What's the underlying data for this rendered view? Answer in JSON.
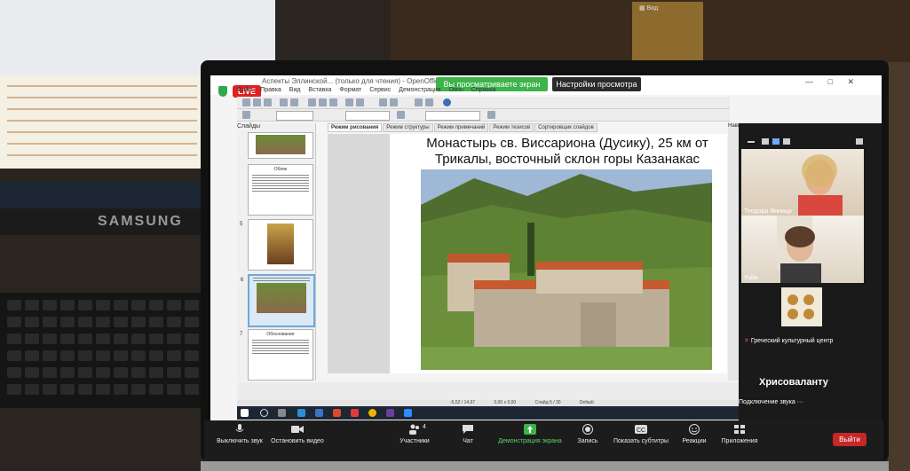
{
  "impress": {
    "window_title": "Аспекты Эллинской... (только для чтения) - OpenOffice Impress",
    "live_badge": "LIVE",
    "menu": [
      "Файл",
      "Правка",
      "Вид",
      "Вставка",
      "Формат",
      "Сервис",
      "Демонстрация",
      "Окно",
      "Справка"
    ],
    "view_tabs": [
      "Режим рисования",
      "Режим структуры",
      "Режим примечаний",
      "Режим тезисов",
      "Сортировщик слайдов"
    ],
    "slides_panel_title": "Слайды",
    "navigator_title": "Навигатор",
    "thumbnails": [
      {
        "num": "",
        "title": ""
      },
      {
        "num": "",
        "title": "Облик"
      },
      {
        "num": "5",
        "title": ""
      },
      {
        "num": "6",
        "title": ""
      },
      {
        "num": "7",
        "title": "Обоснование"
      }
    ],
    "slide_title_line1": "Монастырь св. Виссариона  (Дусику), 25 км от",
    "slide_title_line2": "Трикалы, восточный склон горы Казанакас",
    "status_coords": "-5,52 / 14,97",
    "status_size": "0,00 x 0,00",
    "status_slide": "Слайд 5 / 30",
    "status_layout": "Default"
  },
  "zoom": {
    "share_banner": "Вы просматриваете экран Yulia",
    "view_settings": "Настройки просмотра",
    "view_label": "Вид",
    "participants": [
      {
        "name": "Теодора Янници"
      },
      {
        "name": "Yulia"
      },
      {
        "name": "Греческий культурный центр"
      }
    ],
    "large_name": "Хрисоваланту",
    "audio_status": "Подключение звука ···",
    "participants_count": "4",
    "controls": [
      {
        "label": "Выключить звук",
        "icon": "microphone-icon"
      },
      {
        "label": "Остановить видео",
        "icon": "video-camera-icon"
      },
      {
        "label": "Участники",
        "icon": "participants-icon"
      },
      {
        "label": "Чат",
        "icon": "chat-icon"
      },
      {
        "label": "Демонстрация экрана",
        "icon": "share-screen-icon"
      },
      {
        "label": "Запись",
        "icon": "record-icon"
      },
      {
        "label": "Показать субтитры",
        "icon": "captions-icon"
      },
      {
        "label": "Реакции",
        "icon": "reactions-icon"
      },
      {
        "label": "Приложения",
        "icon": "apps-icon"
      }
    ],
    "leave_label": "Выйти",
    "accent_green": "#3cb44a",
    "leave_red": "#c62828"
  },
  "background": {
    "monitor_brand": "SAMSUNG"
  }
}
